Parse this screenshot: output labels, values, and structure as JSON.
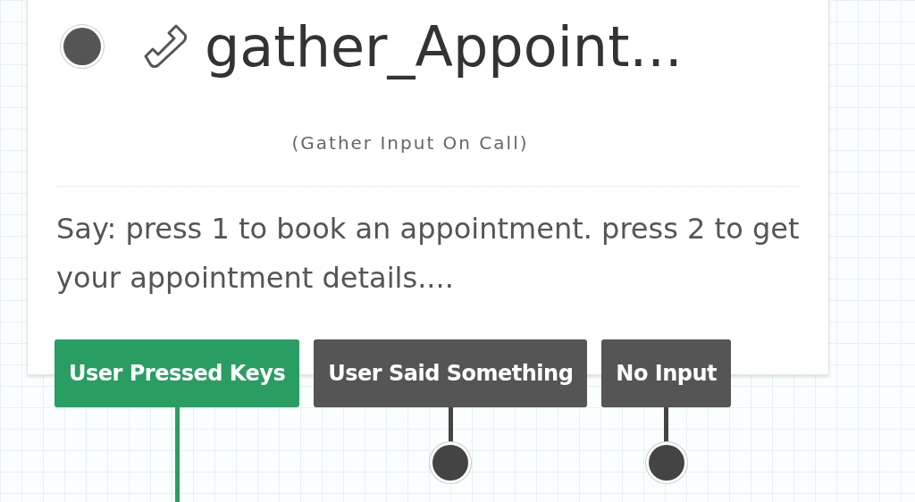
{
  "widget": {
    "title": "gather_Appoint...",
    "type_label": "(Gather Input On Call)",
    "description": "Say: press 1 to book an appointment. press 2 to get your appointment details....",
    "transitions": [
      {
        "label": "User Pressed Keys",
        "connected": true
      },
      {
        "label": "User Said Something",
        "connected": false
      },
      {
        "label": "No Input",
        "connected": false
      }
    ]
  }
}
